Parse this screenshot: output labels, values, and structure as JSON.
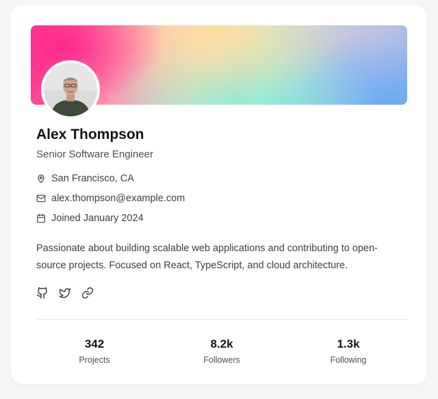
{
  "profile": {
    "name": "Alex Thompson",
    "title": "Senior Software Engineer",
    "location": "San Francisco, CA",
    "email": "alex.thompson@example.com",
    "joined": "Joined January 2024",
    "bio": "Passionate about building scalable web applications and contributing to open-source projects. Focused on React, TypeScript, and cloud architecture."
  },
  "icons": {
    "location": "map-pin-icon",
    "email": "mail-icon",
    "joined": "calendar-icon",
    "github": "github-icon",
    "twitter": "twitter-icon",
    "link": "link-icon"
  },
  "stats": [
    {
      "value": "342",
      "label": "Projects"
    },
    {
      "value": "8.2k",
      "label": "Followers"
    },
    {
      "value": "1.3k",
      "label": "Following"
    }
  ],
  "colors": {
    "card": "#ffffff",
    "background": "#f5f6f8",
    "text": "#111418",
    "muted": "#4a4f57",
    "divider": "#e5e7eb"
  }
}
